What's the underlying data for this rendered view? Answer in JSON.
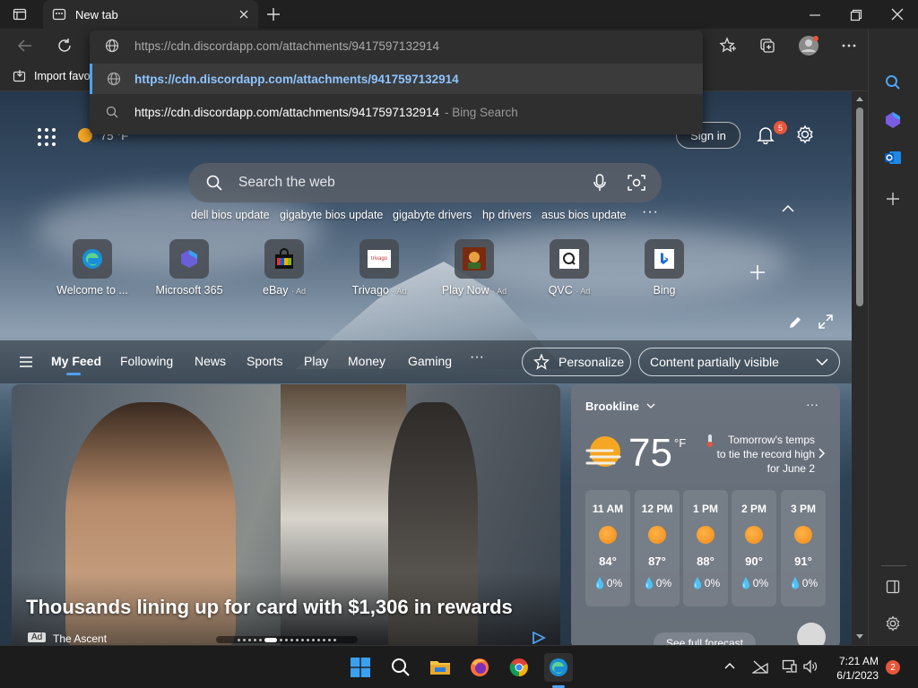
{
  "tab": {
    "title": "New tab"
  },
  "address_bar": {
    "url": "https://cdn.discordapp.com/attachments/9417597132914"
  },
  "omnibox": {
    "suggestions": [
      {
        "prefix": "https://",
        "bold": "cdn.discordapp.com/attachments/9417597132914",
        "suffix": ""
      },
      {
        "text": "https://cdn.discordapp.com/attachments/9417597132914",
        "hint": "- Bing Search"
      }
    ]
  },
  "favorites_bar": {
    "import_label": "Import favo"
  },
  "header": {
    "weather_temp": "75 °F",
    "sign_in": "Sign in",
    "notification_count": "5"
  },
  "search": {
    "placeholder": "Search the web"
  },
  "trending": [
    "dell bios update",
    "gigabyte bios update",
    "gigabyte drivers",
    "hp drivers",
    "asus bios update"
  ],
  "quick_links": [
    {
      "label": "Welcome to ...",
      "ad": ""
    },
    {
      "label": "Microsoft 365",
      "ad": ""
    },
    {
      "label": "eBay",
      "ad": "· Ad"
    },
    {
      "label": "Trivago",
      "ad": "· Ad"
    },
    {
      "label": "Play Now",
      "ad": "· Ad"
    },
    {
      "label": "QVC",
      "ad": "· Ad"
    },
    {
      "label": "Bing",
      "ad": ""
    }
  ],
  "quick_link_icon_text": {
    "trivago": "trivago"
  },
  "feed": {
    "tabs": [
      "My Feed",
      "Following",
      "News",
      "Sports",
      "Play",
      "Money",
      "Gaming"
    ],
    "personalize": "Personalize",
    "content_filter": "Content partially visible"
  },
  "hero": {
    "headline": "Thousands lining up for card with $1,306 in rewards",
    "ad_badge": "Ad",
    "source": "The Ascent"
  },
  "weather": {
    "location": "Brookline",
    "temp": "75",
    "unit": "°F",
    "note": "Tomorrow's temps to tie the record high for June 2",
    "hourly": [
      {
        "hour": "11 AM",
        "temp": "84°",
        "precip": "0%"
      },
      {
        "hour": "12 PM",
        "temp": "87°",
        "precip": "0%"
      },
      {
        "hour": "1 PM",
        "temp": "88°",
        "precip": "0%"
      },
      {
        "hour": "2 PM",
        "temp": "90°",
        "precip": "0%"
      },
      {
        "hour": "3 PM",
        "temp": "91°",
        "precip": "0%"
      }
    ],
    "forecast_link": "See full forecast"
  },
  "taskbar": {
    "time": "7:21 AM",
    "date": "6/1/2023",
    "notification_count": "2"
  },
  "colors": {
    "accent": "#4ea1f0",
    "badge": "#e8553b",
    "bing": "#1e6fd9"
  }
}
